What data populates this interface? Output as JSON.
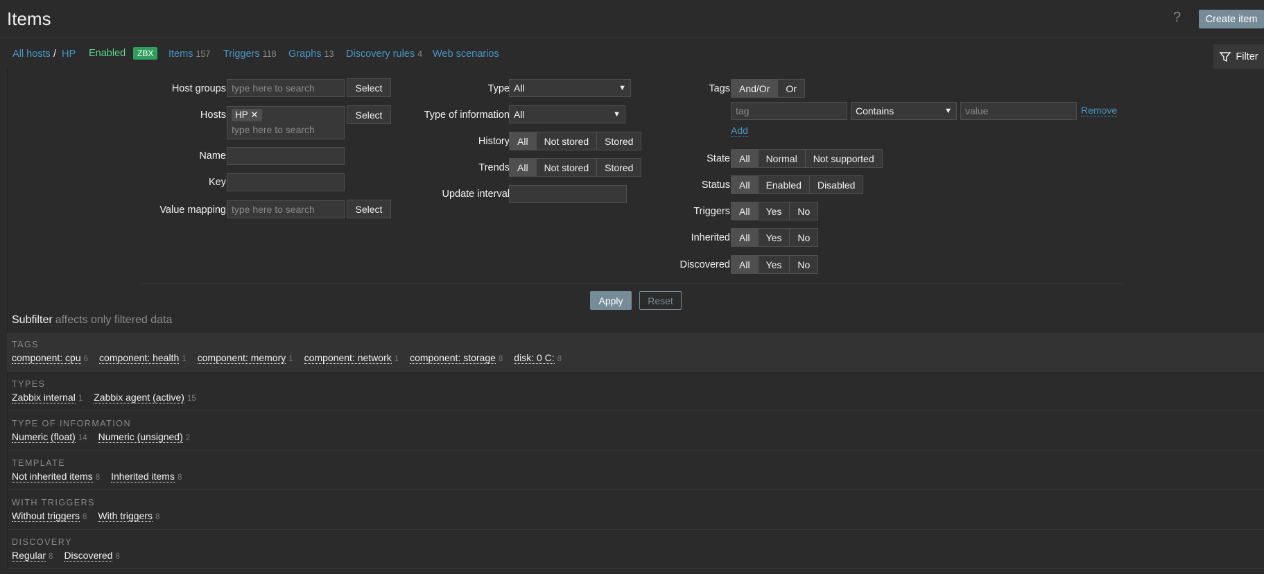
{
  "header": {
    "title": "Items",
    "help": "?",
    "create_label": "Create item"
  },
  "nav": {
    "all_hosts": "All hosts",
    "sep": "/",
    "host": "HP",
    "status": "Enabled",
    "zbx": "ZBX",
    "items_label": "Items",
    "items_count": "157",
    "triggers_label": "Triggers",
    "triggers_count": "118",
    "graphs_label": "Graphs",
    "graphs_count": "13",
    "discovery_label": "Discovery rules",
    "discovery_count": "4",
    "web_label": "Web scenarios",
    "filter_label": "Filter"
  },
  "filter": {
    "host_groups_label": "Host groups",
    "host_groups_placeholder": "type here to search",
    "hosts_label": "Hosts",
    "host_chip": "HP",
    "hosts_placeholder": "type here to search",
    "name_label": "Name",
    "key_label": "Key",
    "value_mapping_label": "Value mapping",
    "value_mapping_placeholder": "type here to search",
    "select_label": "Select",
    "type_label": "Type",
    "type_value": "All",
    "type_info_label": "Type of information",
    "type_info_value": "All",
    "history_label": "History",
    "history_options": [
      "All",
      "Not stored",
      "Stored"
    ],
    "trends_label": "Trends",
    "trends_options": [
      "All",
      "Not stored",
      "Stored"
    ],
    "update_interval_label": "Update interval",
    "tags_label": "Tags",
    "tags_options": [
      "And/Or",
      "Or"
    ],
    "tag_placeholder": "tag",
    "tag_operator": "Contains",
    "tag_value_placeholder": "value",
    "remove_label": "Remove",
    "add_label": "Add",
    "state_label": "State",
    "state_options": [
      "All",
      "Normal",
      "Not supported"
    ],
    "status_label": "Status",
    "status_options": [
      "All",
      "Enabled",
      "Disabled"
    ],
    "triggers_label": "Triggers",
    "triggers_options": [
      "All",
      "Yes",
      "No"
    ],
    "inherited_label": "Inherited",
    "inherited_options": [
      "All",
      "Yes",
      "No"
    ],
    "discovered_label": "Discovered",
    "discovered_options": [
      "All",
      "Yes",
      "No"
    ],
    "apply_label": "Apply",
    "reset_label": "Reset"
  },
  "subfilter": {
    "title": "Subfilter",
    "hint": "affects only filtered data",
    "sections": [
      {
        "heading": "TAGS",
        "items": [
          {
            "label": "component: cpu",
            "count": "6"
          },
          {
            "label": "component: health",
            "count": "1"
          },
          {
            "label": "component: memory",
            "count": "1"
          },
          {
            "label": "component: network",
            "count": "1"
          },
          {
            "label": "component: storage",
            "count": "8"
          },
          {
            "label": "disk: 0 C:",
            "count": "8"
          }
        ]
      },
      {
        "heading": "TYPES",
        "items": [
          {
            "label": "Zabbix internal",
            "count": "1"
          },
          {
            "label": "Zabbix agent (active)",
            "count": "15"
          }
        ]
      },
      {
        "heading": "TYPE OF INFORMATION",
        "items": [
          {
            "label": "Numeric (float)",
            "count": "14"
          },
          {
            "label": "Numeric (unsigned)",
            "count": "2"
          }
        ]
      },
      {
        "heading": "TEMPLATE",
        "items": [
          {
            "label": "Not inherited items",
            "count": "8"
          },
          {
            "label": "Inherited items",
            "count": "8"
          }
        ]
      },
      {
        "heading": "WITH TRIGGERS",
        "items": [
          {
            "label": "Without triggers",
            "count": "8"
          },
          {
            "label": "With triggers",
            "count": "8"
          }
        ]
      },
      {
        "heading": "DISCOVERY",
        "items": [
          {
            "label": "Regular",
            "count": "8"
          },
          {
            "label": "Discovered",
            "count": "8"
          }
        ]
      }
    ]
  }
}
